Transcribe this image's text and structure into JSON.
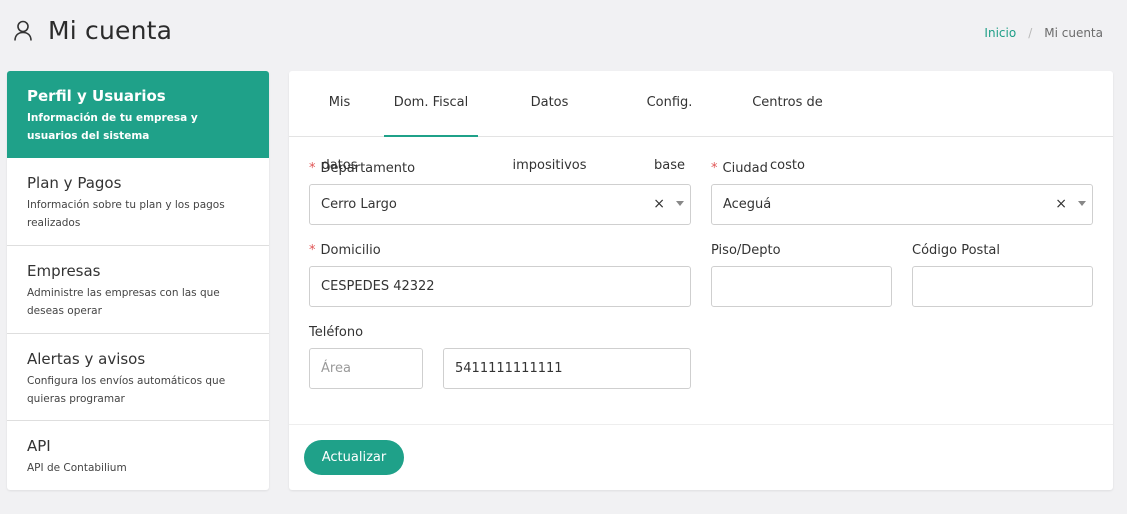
{
  "header": {
    "title": "Mi cuenta",
    "icon": "user-icon",
    "breadcrumb": {
      "home": "Inicio",
      "separator": "/",
      "current": "Mi cuenta"
    }
  },
  "colors": {
    "accent": "#1fa189",
    "required": "#e05454",
    "background": "#f1f1f3"
  },
  "sidebar": {
    "items": [
      {
        "title": "Perfil y Usuarios",
        "desc": "Información de tu empresa y usuarios del sistema",
        "active": true
      },
      {
        "title": "Plan y Pagos",
        "desc": "Información sobre tu plan y los pagos realizados"
      },
      {
        "title": "Empresas",
        "desc": "Administre las empresas con las que deseas operar"
      },
      {
        "title": "Alertas y avisos",
        "desc": "Configura los envíos automáticos que quieras programar"
      },
      {
        "title": "API",
        "desc": "API de Contabilium"
      }
    ]
  },
  "tabs": [
    {
      "label": "Mis datos"
    },
    {
      "label": "Dom. Fiscal",
      "active": true
    },
    {
      "label": "Datos impositivos"
    },
    {
      "label": "Config. base"
    },
    {
      "label": "Centros de costo"
    }
  ],
  "form": {
    "departamento": {
      "label": "Departamento",
      "value": "Cerro Largo",
      "clear": "×",
      "required": true
    },
    "ciudad": {
      "label": "Ciudad",
      "value": "Aceguá",
      "clear": "×",
      "required": true
    },
    "domicilio": {
      "label": "Domicilio",
      "value": "CESPEDES 42322",
      "required": true
    },
    "piso": {
      "label": "Piso/Depto",
      "value": ""
    },
    "codigo_postal": {
      "label": "Código Postal",
      "value": ""
    },
    "telefono": {
      "label": "Teléfono",
      "area_placeholder": "Área",
      "area_value": "",
      "number_value": "5411111111111"
    },
    "required_marker": "*"
  },
  "actions": {
    "update_label": "Actualizar"
  }
}
